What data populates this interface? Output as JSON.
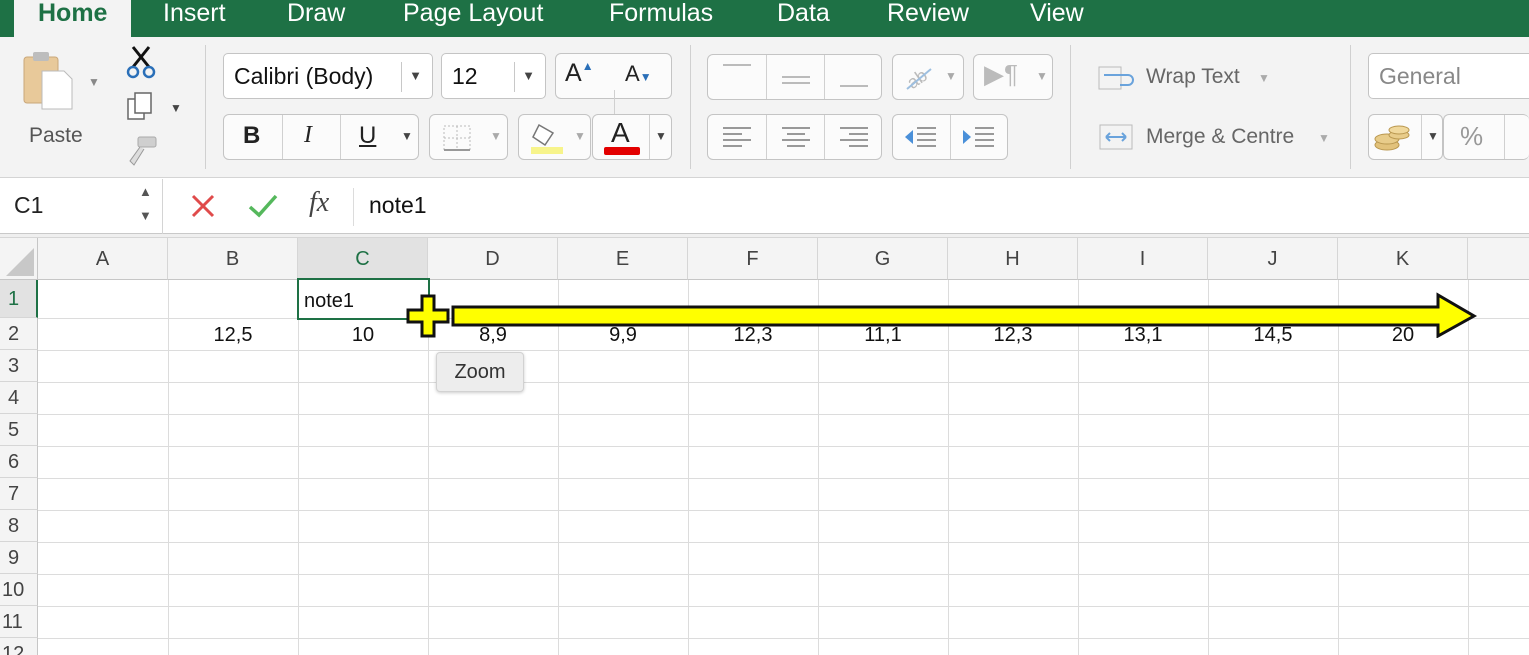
{
  "tabs": [
    "Home",
    "Insert",
    "Draw",
    "Page Layout",
    "Formulas",
    "Data",
    "Review",
    "View"
  ],
  "ribbon": {
    "paste_label": "Paste",
    "font_name": "Calibri (Body)",
    "font_size": "12",
    "bold": "B",
    "italic": "I",
    "underline": "U",
    "font_color_glyph": "A",
    "wrap_text": "Wrap Text",
    "merge_centre": "Merge & Centre",
    "number_format": "General",
    "percent": "%",
    "fill_color": "#f7f48b",
    "font_color": "#e30000"
  },
  "formula_bar": {
    "name_box": "C1",
    "fx": "fx",
    "content": "note1"
  },
  "columns": [
    "A",
    "B",
    "C",
    "D",
    "E",
    "F",
    "G",
    "H",
    "I",
    "J",
    "K"
  ],
  "rows": [
    "1",
    "2",
    "3",
    "4",
    "5",
    "6",
    "7",
    "8",
    "9",
    "10",
    "11",
    "12"
  ],
  "cells": {
    "C1": "note1",
    "B2": "12,5",
    "C2": "10",
    "D2": "8,9",
    "E2": "9,9",
    "F2": "12,3",
    "G2": "11,1",
    "H2": "12,3",
    "I2": "13,1",
    "J2": "14,5",
    "K2": "20"
  },
  "tooltip": "Zoom",
  "colors": {
    "accent": "#1e7145",
    "arrow": "#ffff00"
  }
}
